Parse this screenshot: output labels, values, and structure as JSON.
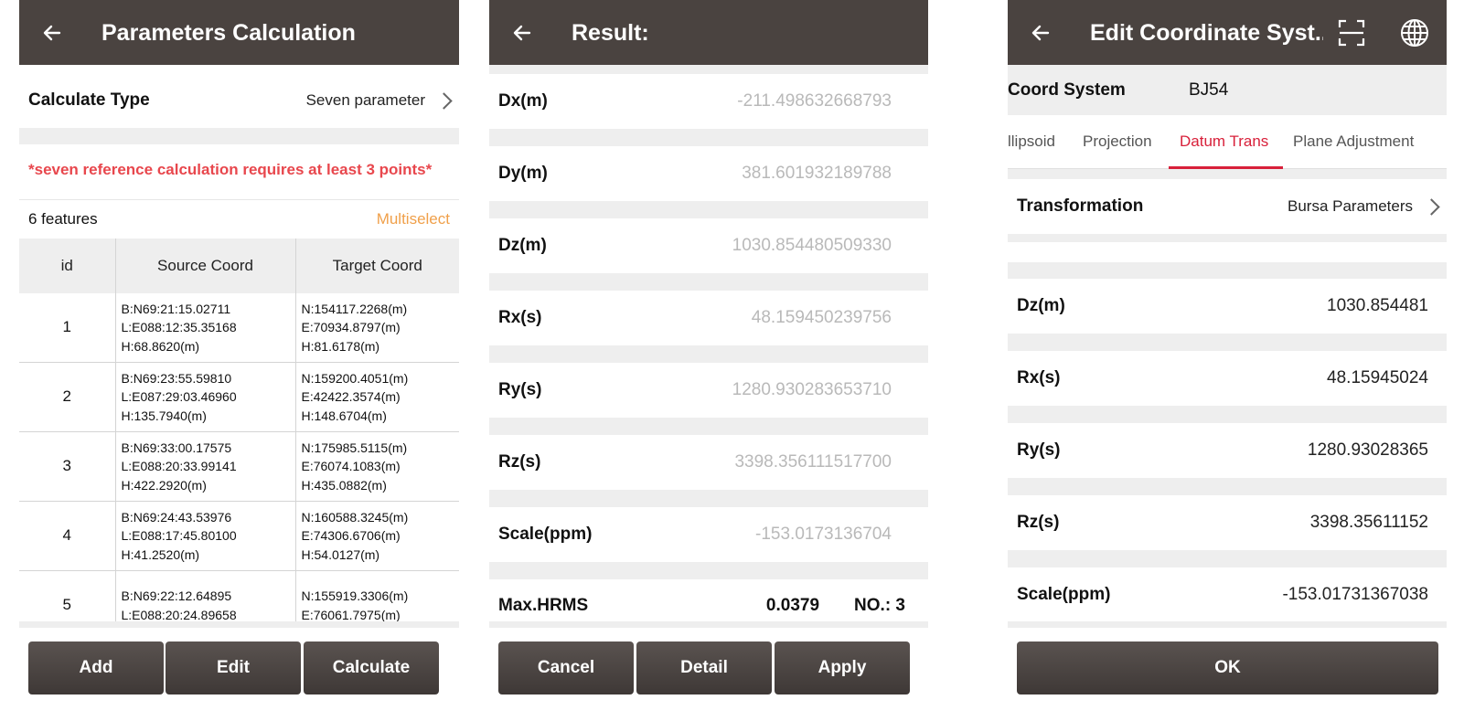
{
  "panel1": {
    "title": "Parameters Calculation",
    "calc_type_label": "Calculate Type",
    "calc_type_value": "Seven parameter",
    "warning": "*seven reference calculation requires at least 3 points*",
    "features_count": "6 features",
    "multiselect": "Multiselect",
    "columns": [
      "id",
      "Source Coord",
      "Target Coord"
    ],
    "rows": [
      {
        "id": "1",
        "src": [
          "B:N69:21:15.02711",
          "L:E088:12:35.35168",
          "H:68.8620(m)"
        ],
        "tgt": [
          "N:154117.2268(m)",
          "E:70934.8797(m)",
          "H:81.6178(m)"
        ]
      },
      {
        "id": "2",
        "src": [
          "B:N69:23:55.59810",
          "L:E087:29:03.46960",
          "H:135.7940(m)"
        ],
        "tgt": [
          "N:159200.4051(m)",
          "E:42422.3574(m)",
          "H:148.6704(m)"
        ]
      },
      {
        "id": "3",
        "src": [
          "B:N69:33:00.17575",
          "L:E088:20:33.99141",
          "H:422.2920(m)"
        ],
        "tgt": [
          "N:175985.5115(m)",
          "E:76074.1083(m)",
          "H:435.0882(m)"
        ]
      },
      {
        "id": "4",
        "src": [
          "B:N69:24:43.53976",
          "L:E088:17:45.80100",
          "H:41.2520(m)"
        ],
        "tgt": [
          "N:160588.3245(m)",
          "E:74306.6706(m)",
          "H:54.0127(m)"
        ]
      },
      {
        "id": "5",
        "src": [
          "B:N69:22:12.64895",
          "L:E088:20:24.89658",
          ""
        ],
        "tgt": [
          "N:155919.3306(m)",
          "E:76061.7975(m)",
          ""
        ]
      }
    ],
    "buttons": {
      "add": "Add",
      "edit": "Edit",
      "calculate": "Calculate"
    }
  },
  "panel2": {
    "title": "Result:",
    "rows": [
      {
        "label": "Dx(m)",
        "value": "-211.498632668793"
      },
      {
        "label": "Dy(m)",
        "value": "381.601932189788"
      },
      {
        "label": "Dz(m)",
        "value": "1030.854480509330"
      },
      {
        "label": "Rx(s)",
        "value": "48.159450239756"
      },
      {
        "label": "Ry(s)",
        "value": "1280.930283653710"
      },
      {
        "label": "Rz(s)",
        "value": "3398.356111517700"
      },
      {
        "label": "Scale(ppm)",
        "value": "-153.0173136704"
      }
    ],
    "hrms_label": "Max.HRMS",
    "hrms_value": "0.0379",
    "no_label": "NO.: 3",
    "buttons": {
      "cancel": "Cancel",
      "detail": "Detail",
      "apply": "Apply"
    }
  },
  "panel3": {
    "title": "Edit Coordinate Syst...",
    "coord_system_label": "Coord System",
    "coord_system_value": "BJ54",
    "tabs": [
      "llipsoid",
      "Projection",
      "Datum Trans",
      "Plane Adjustment"
    ],
    "active_tab": "Datum Trans",
    "transformation_label": "Transformation",
    "transformation_value": "Bursa Parameters",
    "rows": [
      {
        "label": "Dz(m)",
        "value": "1030.854481"
      },
      {
        "label": "Rx(s)",
        "value": "48.15945024"
      },
      {
        "label": "Ry(s)",
        "value": "1280.93028365"
      },
      {
        "label": "Rz(s)",
        "value": "3398.35611152"
      },
      {
        "label": "Scale(ppm)",
        "value": "-153.01731367038"
      }
    ],
    "ok": "OK"
  },
  "icons": {
    "back": "arrow-left-icon",
    "scan": "scan-frame-icon",
    "globe": "globe-icon",
    "chevron": "chevron-right-icon"
  },
  "colors": {
    "topbar": "#4a4340",
    "accent_red": "#d8203a",
    "warning_red": "#e8474d",
    "multiselect_orange": "#f0a04a",
    "muted_value": "#b9b9b9",
    "separator": "#eeeeee"
  }
}
